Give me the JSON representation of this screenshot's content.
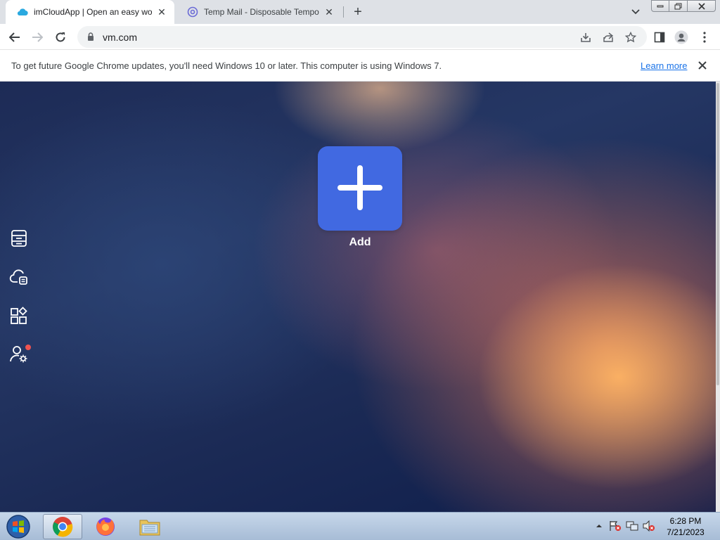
{
  "browser": {
    "tabs": [
      {
        "title": "imCloudApp | Open an easy work",
        "active": true
      },
      {
        "title": "Temp Mail - Disposable Tempora",
        "active": false
      }
    ],
    "new_tab_label": "+",
    "url": "vm.com"
  },
  "infobar": {
    "message": "To get future Google Chrome updates, you'll need Windows 10 or later. This computer is using Windows 7.",
    "learn_more": "Learn more"
  },
  "page": {
    "add_label": "Add",
    "sidebar_icons": [
      "storage-icon",
      "cloud-drive-icon",
      "apps-icon",
      "user-settings-icon"
    ],
    "colors": {
      "accent": "#4169e1",
      "notification": "#ef5350"
    }
  },
  "taskbar": {
    "apps": [
      "chrome-icon",
      "firefox-icon",
      "file-explorer-icon"
    ],
    "time": "6:28 PM",
    "date": "7/21/2023"
  }
}
